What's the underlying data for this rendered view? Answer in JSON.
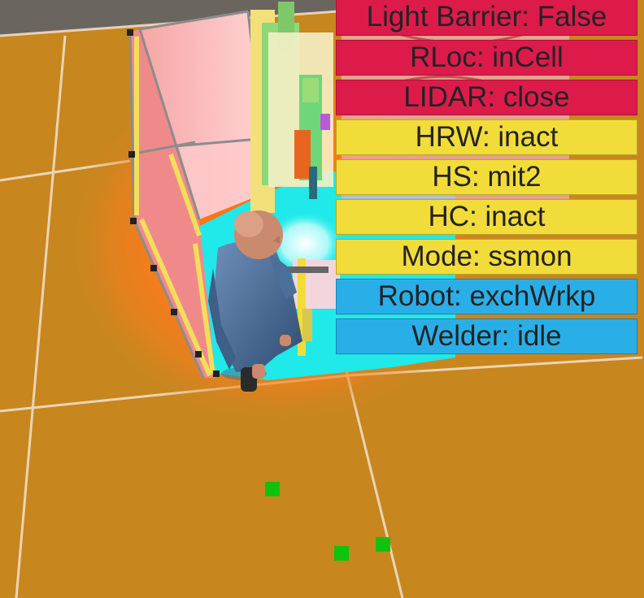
{
  "colors": {
    "floor": "#c8861f",
    "alarm_red": "#dc1b4b",
    "status_yellow": "#f2dc3a",
    "info_blue": "#2aaee8",
    "safety_zone": "#1fe9e9",
    "marker_green": "#0ec30e"
  },
  "status_panel": [
    {
      "label": "Light Barrier: False",
      "state": "alarm_red"
    },
    {
      "label": "RLoc: inCell",
      "state": "alarm_red"
    },
    {
      "label": "LIDAR: close",
      "state": "alarm_red"
    },
    {
      "label": "HRW: inact",
      "state": "status_yellow"
    },
    {
      "label": "HS: mit2",
      "state": "status_yellow"
    },
    {
      "label": "HC: inact",
      "state": "status_yellow"
    },
    {
      "label": "Mode: ssmon",
      "state": "status_yellow"
    },
    {
      "label": "Robot: exchWrkp",
      "state": "info_blue"
    },
    {
      "label": "Welder: idle",
      "state": "info_blue"
    }
  ]
}
